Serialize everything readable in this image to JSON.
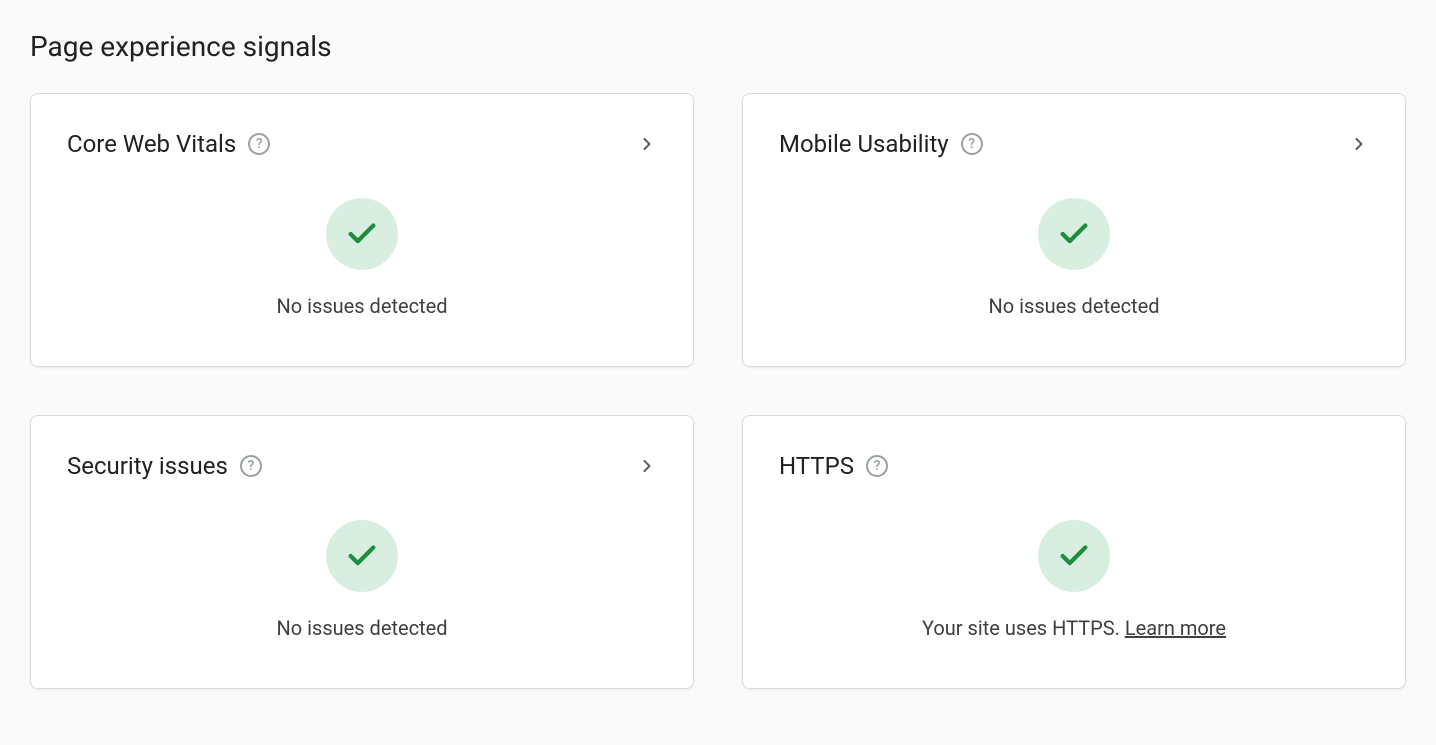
{
  "page": {
    "title": "Page experience signals"
  },
  "cards": {
    "core_web_vitals": {
      "title": "Core Web Vitals",
      "status_text": "No issues detected",
      "has_chevron": true
    },
    "mobile_usability": {
      "title": "Mobile Usability",
      "status_text": "No issues detected",
      "has_chevron": true
    },
    "security_issues": {
      "title": "Security issues",
      "status_text": "No issues detected",
      "has_chevron": true
    },
    "https": {
      "title": "HTTPS",
      "status_text_prefix": "Your site uses HTTPS. ",
      "learn_more_label": "Learn more",
      "has_chevron": false
    }
  },
  "colors": {
    "success_bg": "#d7eee0",
    "success_check": "#1e8e3e"
  }
}
